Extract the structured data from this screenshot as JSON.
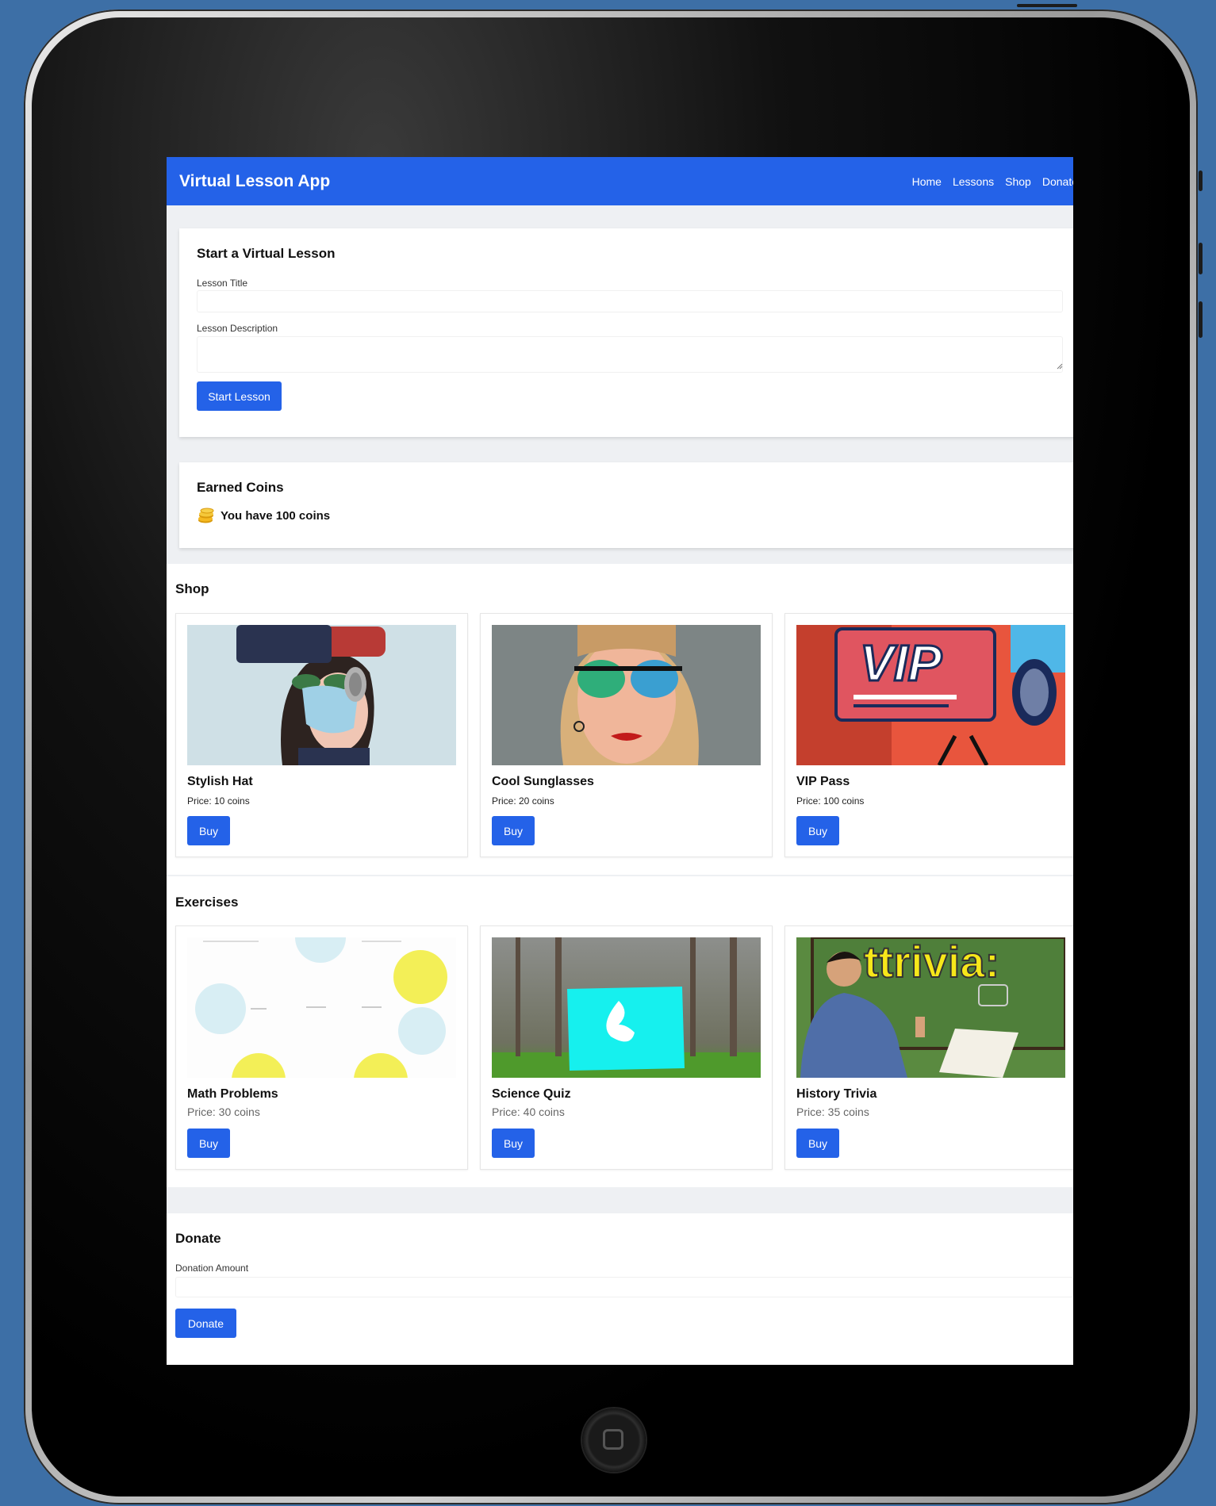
{
  "app": {
    "title": "Virtual Lesson App",
    "nav": [
      "Home",
      "Lessons",
      "Shop",
      "Donate"
    ]
  },
  "lesson_form": {
    "title": "Start a Virtual Lesson",
    "title_label": "Lesson Title",
    "title_value": "",
    "description_label": "Lesson Description",
    "description_value": "",
    "submit_label": "Start Lesson"
  },
  "coins": {
    "title": "Earned Coins",
    "icon": "coins-icon",
    "text": "You have 100 coins"
  },
  "shop": {
    "title": "Shop",
    "items": [
      {
        "name": "Stylish Hat",
        "price": "Price:  10 coins",
        "button": "Buy",
        "image": "stylish-hat-image"
      },
      {
        "name": "Cool Sunglasses",
        "price": "Price: 20 coins",
        "button": "Buy",
        "image": "cool-sunglasses-image"
      },
      {
        "name": "VIP Pass",
        "price": "Price:  100 coins",
        "button": "Buy",
        "image": "vip-pass-image"
      }
    ]
  },
  "exercises": {
    "title": "Exercises",
    "items": [
      {
        "name": "Math Problems",
        "price": "Price: 30 coins",
        "button": "Buy",
        "image": "math-problems-image"
      },
      {
        "name": "Science Quiz",
        "price": "Price: 40 coins",
        "button": "Buy",
        "image": "science-quiz-image"
      },
      {
        "name": "History Trivia",
        "price": "Price: 35 coins",
        "button": "Buy",
        "image": "history-trivia-image"
      }
    ]
  },
  "donate": {
    "title": "Donate",
    "amount_label": "Donation Amount",
    "amount_value": "",
    "button": "Donate"
  },
  "image_text": {
    "vip": "VIP",
    "trivia": "ttrivia:"
  },
  "colors": {
    "primary": "#2462e8",
    "page_bg": "#3d6fa6"
  }
}
